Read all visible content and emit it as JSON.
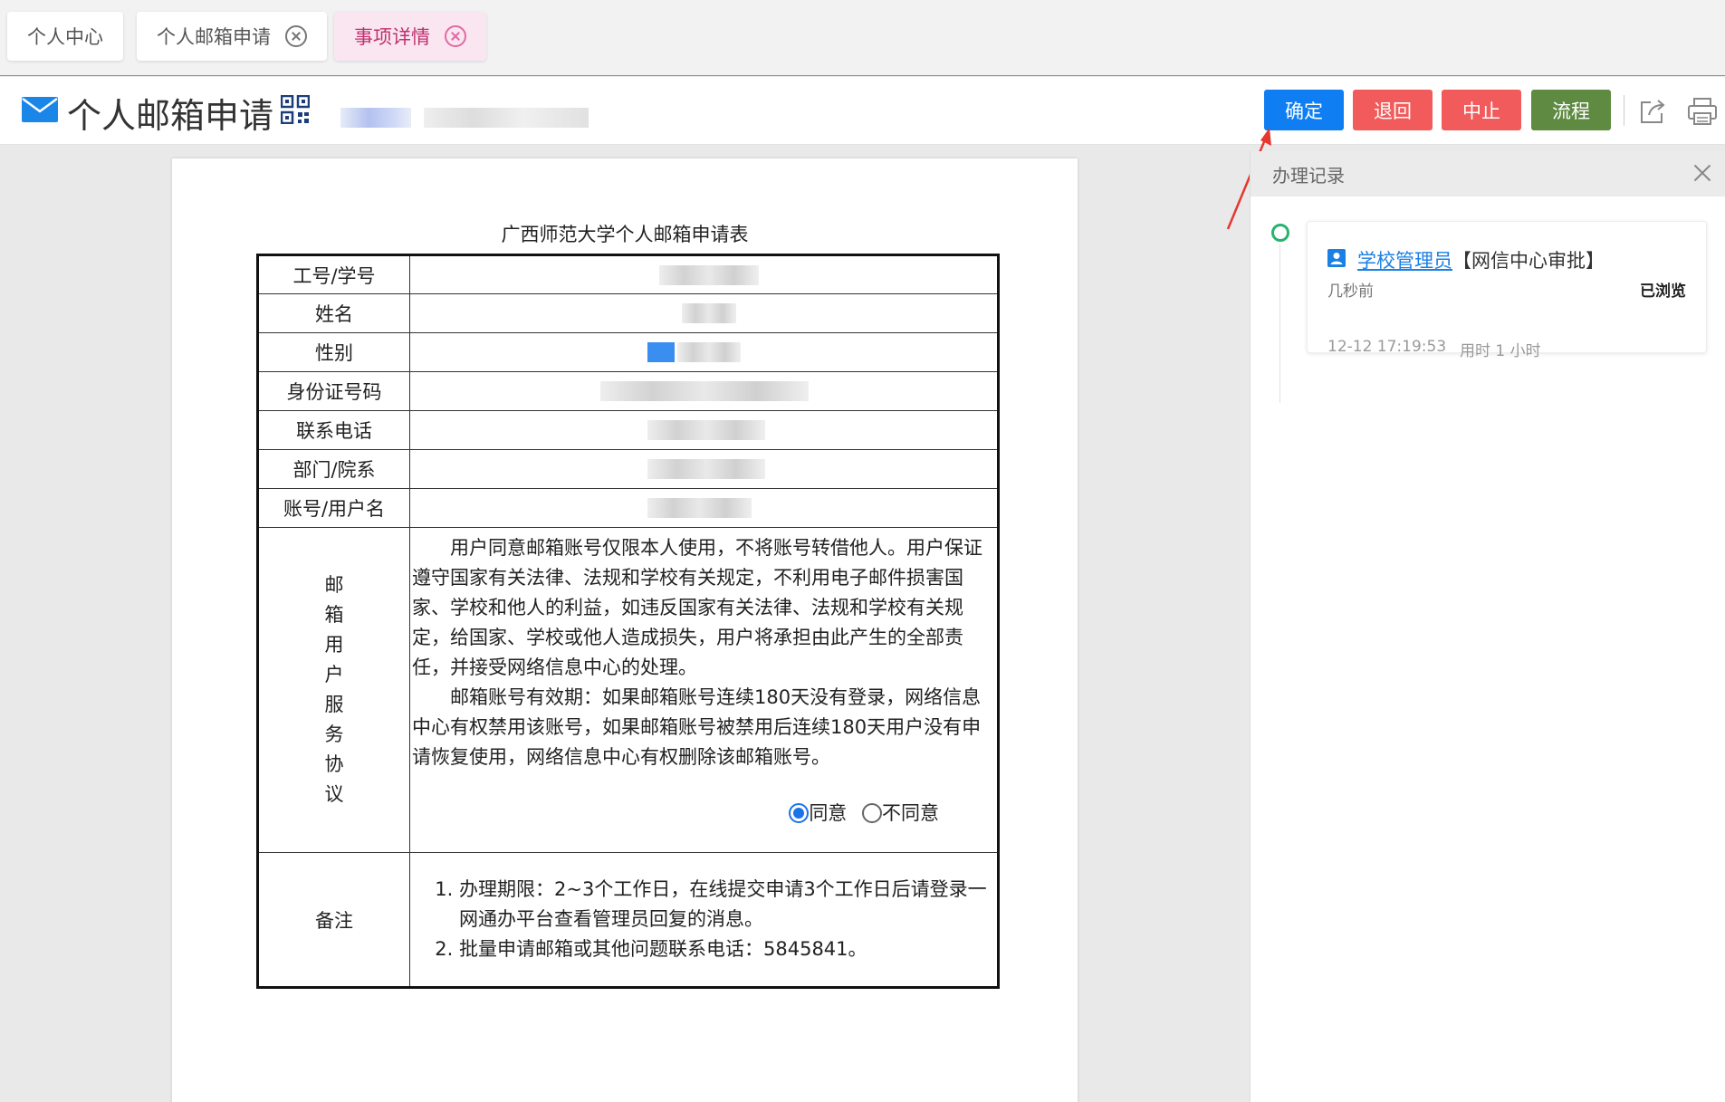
{
  "tabs": [
    {
      "label": "个人中心"
    },
    {
      "label": "个人邮箱申请"
    },
    {
      "label": "事项详情"
    }
  ],
  "header": {
    "title": "个人邮箱申请",
    "buttons": {
      "confirm": "确定",
      "return": "退回",
      "stop": "中止",
      "flow": "流程"
    }
  },
  "form": {
    "title": "广西师范大学个人邮箱申请表",
    "rows": [
      {
        "label": "工号/学号"
      },
      {
        "label": "姓名"
      },
      {
        "label": "性别"
      },
      {
        "label": "身份证号码"
      },
      {
        "label": "联系电话"
      },
      {
        "label": "部门/院系"
      },
      {
        "label": "账号/用户名"
      }
    ],
    "agreement_label": [
      "邮",
      "箱",
      "用",
      "户",
      "服",
      "务",
      "协",
      "议"
    ],
    "agreement_p1": "用户同意邮箱账号仅限本人使用，不将账号转借他人。用户保证遵守国家有关法律、法规和学校有关规定，不利用电子邮件损害国家、学校和他人的利益，如违反国家有关法律、法规和学校有关规定，给国家、学校或他人造成损失，用户将承担由此产生的全部责任，并接受网络信息中心的处理。",
    "agreement_p2": "邮箱账号有效期：如果邮箱账号连续180天没有登录，网络信息中心有权禁用该账号，如果邮箱账号被禁用后连续180天用户没有申请恢复使用，网络信息中心有权删除该邮箱账号。",
    "agree": "同意",
    "disagree": "不同意",
    "agree_selected": true,
    "notes_label": "备注",
    "notes": [
      "办理期限：2~3个工作日，在线提交申请3个工作日后请登录一网通办平台查看管理员回复的消息。",
      "批量申请邮箱或其他问题联系电话：5845841。"
    ]
  },
  "panel": {
    "title": "办理记录",
    "record": {
      "user": "学校管理员",
      "step": "【网信中心审批】",
      "relative_time": "几秒前",
      "status": "已浏览",
      "timestamp": "12-12 17:19:53",
      "duration": "用时 1 小时"
    }
  },
  "colors": {
    "confirm": "#0e7ef2",
    "danger": "#f15b5b",
    "flow": "#5e8b41",
    "link": "#1b7fe3",
    "timeline": "#27b36f"
  }
}
